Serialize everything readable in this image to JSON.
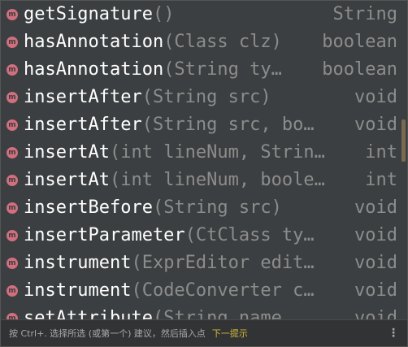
{
  "completion": {
    "items": [
      {
        "icon": "method-icon",
        "icon_letter": "m",
        "name": "getSignature",
        "params": "()",
        "type": "String"
      },
      {
        "icon": "method-icon",
        "icon_letter": "m",
        "name": "hasAnnotation",
        "params": "(Class clz)",
        "type": "boolean"
      },
      {
        "icon": "method-icon",
        "icon_letter": "m",
        "name": "hasAnnotation",
        "params": "(String ty…",
        "type": "boolean"
      },
      {
        "icon": "method-icon",
        "icon_letter": "m",
        "name": "insertAfter",
        "params": "(String src)",
        "type": "void"
      },
      {
        "icon": "method-icon",
        "icon_letter": "m",
        "name": "insertAfter",
        "params": "(String src, bo…",
        "type": "void"
      },
      {
        "icon": "method-icon",
        "icon_letter": "m",
        "name": "insertAt",
        "params": "(int lineNum, Strin…",
        "type": "int"
      },
      {
        "icon": "method-icon",
        "icon_letter": "m",
        "name": "insertAt",
        "params": "(int lineNum, boole…",
        "type": "int"
      },
      {
        "icon": "method-icon",
        "icon_letter": "m",
        "name": "insertBefore",
        "params": "(String src)",
        "type": "void"
      },
      {
        "icon": "method-icon",
        "icon_letter": "m",
        "name": "insertParameter",
        "params": "(CtClass ty…",
        "type": "void"
      },
      {
        "icon": "method-icon",
        "icon_letter": "m",
        "name": "instrument",
        "params": "(ExprEditor edit…",
        "type": "void"
      },
      {
        "icon": "method-icon",
        "icon_letter": "m",
        "name": "instrument",
        "params": "(CodeConverter c…",
        "type": "void"
      },
      {
        "icon": "method-icon",
        "icon_letter": "m",
        "name": "setAttribute",
        "params": "(String name…",
        "type": "void"
      }
    ]
  },
  "footer": {
    "hint_text": "按 Ctrl+. 选择所选 (或第一个) 建议，然后插入点",
    "next_tip_label": "下一提示",
    "more_glyph": "⋮"
  },
  "colors": {
    "background": "#3c3f41",
    "method_icon": "#d16f7e",
    "name_text": "#ffffff",
    "secondary_text": "#8c8c8c",
    "link_accent": "#d4b93a"
  }
}
